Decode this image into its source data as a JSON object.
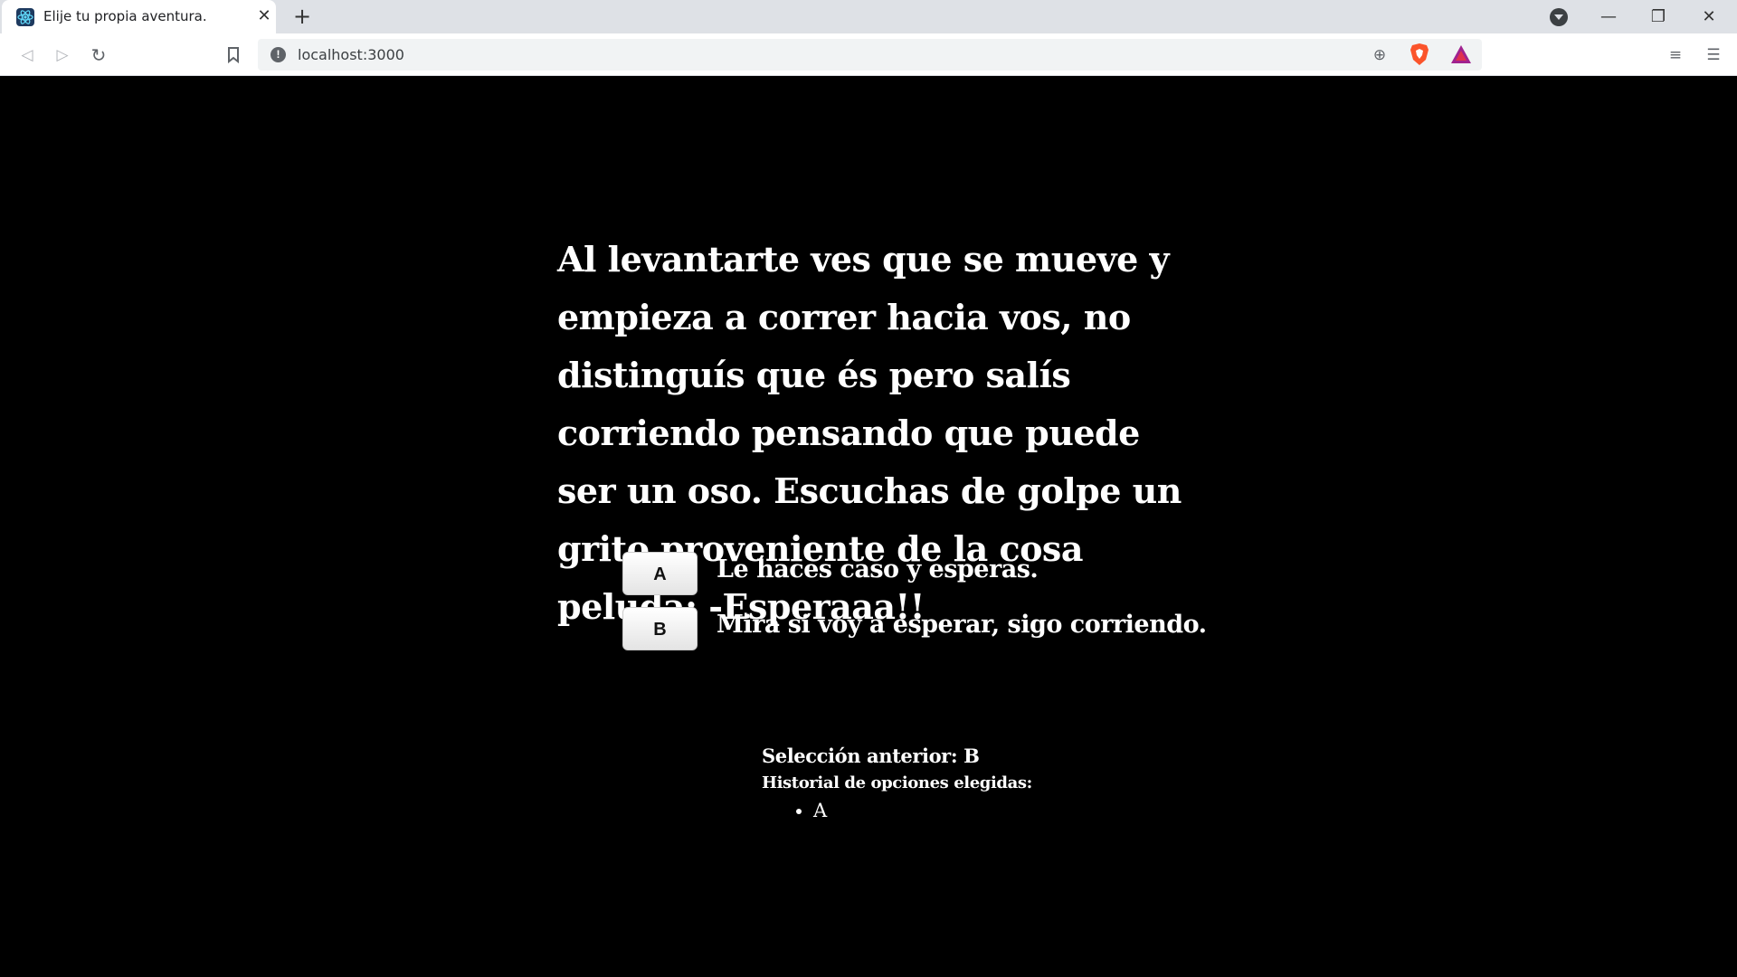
{
  "browser": {
    "tab": {
      "title": "Elije tu propia aventura.",
      "close_glyph": "✕",
      "favicon": "react-icon"
    },
    "new_tab_glyph": "+",
    "window_controls": {
      "minimize": "—",
      "maximize": "❐",
      "close": "✕"
    },
    "nav": {
      "back": "◁",
      "forward": "▷",
      "reload": "↻",
      "bookmark": "🔖"
    },
    "url": "localhost:3000",
    "url_info_glyph": "!",
    "zoom_glyph": "⊕",
    "playlist_glyph": "≡",
    "menu_glyph": "☰"
  },
  "story": {
    "text": "Al levantarte ves que se mueve y empieza a correr hacia vos, no distinguís que és pero salís corriendo pensando que puede ser un oso. Escuchas de golpe un grito proveniente de la cosa peluda: -Esperaaa!!"
  },
  "options": [
    {
      "key": "A",
      "label": "Le haces caso y esperas."
    },
    {
      "key": "B",
      "label": "Mira si voy a esperar, sigo corriendo."
    }
  ],
  "history": {
    "previous_selection": "Selección anterior: B",
    "title": "Historial de opciones elegidas:",
    "items": [
      "A"
    ]
  }
}
